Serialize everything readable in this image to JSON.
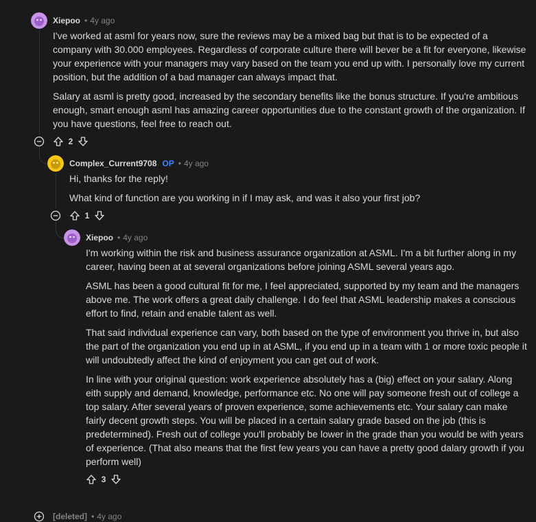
{
  "comments": [
    {
      "author": "Xiepoo",
      "time": "4y ago",
      "paragraphs": [
        "I've worked at asml for years now, sure the reviews may be a mixed bag but that is to be expected of a company with 30.000 employees. Regardless of corporate culture there will bever be a fit for everyone, likewise your experience with your managers may vary based on the team you end up with. I personally love my current position, but the addition of a bad manager can always impact that.",
        "Salary at asml is pretty good, increased by the secondary benefits like the bonus structure. If you're ambitious enough, smart enough asml has amazing career opportunities due to the constant growth of the organization. If you have questions, feel free to reach out."
      ],
      "votes": "2"
    },
    {
      "author": "Complex_Current9708",
      "op_badge": "OP",
      "time": "4y ago",
      "paragraphs": [
        "Hi, thanks for the reply!",
        "What kind of function are you working in if I may ask, and was it also your first job?"
      ],
      "votes": "1"
    },
    {
      "author": "Xiepoo",
      "time": "4y ago",
      "paragraphs": [
        "I'm working within the risk and business assurance organization at ASML. I'm a bit further along in my career, having been at at several organizations before joining ASML several years ago.",
        "ASML has been a good cultural fit for me, I feel appreciated, supported by my team and the managers above me. The work offers a great daily challenge. I do feel that ASML leadership makes a conscious effort to find, retain and enable talent as well.",
        "That said individual experience can vary, both based on the type of environment you thrive in, but also the part of the organization you end up in at ASML, if you end up in a team with 1 or more toxic people it will undoubtedly affect the kind of enjoyment you can get out of work.",
        "In line with your original question: work experience absolutely has a (big) effect on your salary. Along eith supply and demand, knowledge, performance etc. No one will pay someone fresh out of college a top salary. After several years of proven experience, some achievements etc. Your salary can make fairly decent growth steps. You will be placed in a certain salary grade based on the job (this is predetermined). Fresh out of college you'll probably be lower in the grade than you would be with years of experience. (That also means that the first few years you can have a pretty good dalary growth if you perform well)"
      ],
      "votes": "3"
    },
    {
      "author": "[deleted]",
      "time": "4y ago"
    }
  ],
  "colors": {
    "background": "#1a1a1b",
    "text": "#d7dadc",
    "muted": "#818384",
    "op": "#3a86ff",
    "thread_line": "#343536"
  },
  "icons": [
    "avatar-purple",
    "avatar-yellow",
    "collapse-icon",
    "expand-icon",
    "upvote-icon",
    "downvote-icon"
  ]
}
